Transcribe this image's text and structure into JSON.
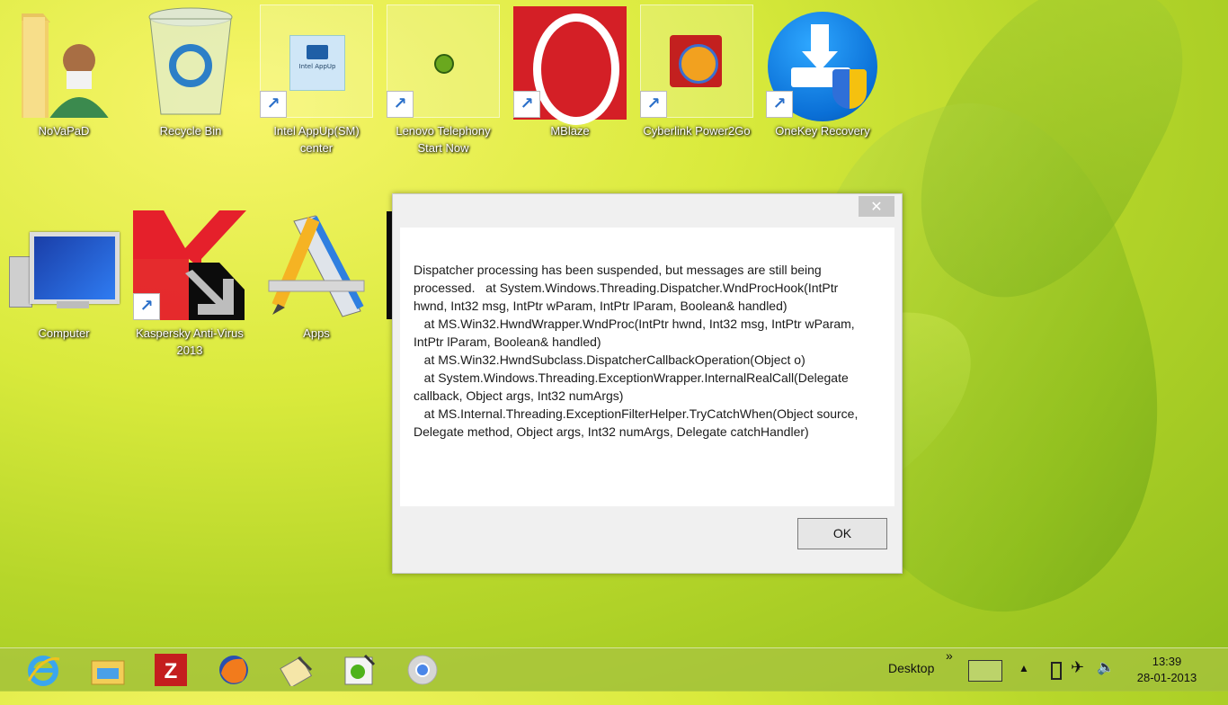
{
  "desktop": {
    "icons": [
      {
        "label": "NoVaPaD",
        "name": "icon-novapad"
      },
      {
        "label": "Recycle Bin",
        "name": "icon-recycle-bin"
      },
      {
        "label": "Intel AppUp(SM) center",
        "name": "icon-intel-appup"
      },
      {
        "label": "Lenovo Telephony Start Now",
        "name": "icon-lenovo-telephony"
      },
      {
        "label": "MBlaze",
        "name": "icon-mblaze"
      },
      {
        "label": "Cyberlink Power2Go",
        "name": "icon-cyberlink"
      },
      {
        "label": "OneKey Recovery",
        "name": "icon-onekey-recovery"
      },
      {
        "label": "Computer",
        "name": "icon-computer"
      },
      {
        "label": "Kaspersky Anti-Virus 2013",
        "name": "icon-kaspersky"
      },
      {
        "label": "Apps",
        "name": "icon-apps"
      }
    ],
    "intel_tile_text": "Intel AppUp"
  },
  "dialog": {
    "close_label": "✕",
    "message": "Dispatcher processing has been suspended, but messages are still being processed.   at System.Windows.Threading.Dispatcher.WndProcHook(IntPtr hwnd, Int32 msg, IntPtr wParam, IntPtr lParam, Boolean& handled)\n   at MS.Win32.HwndWrapper.WndProc(IntPtr hwnd, Int32 msg, IntPtr wParam, IntPtr lParam, Boolean& handled)\n   at MS.Win32.HwndSubclass.DispatcherCallbackOperation(Object o)\n   at System.Windows.Threading.ExceptionWrapper.InternalRealCall(Delegate callback, Object args, Int32 numArgs)\n   at MS.Internal.Threading.ExceptionFilterHelper.TryCatchWhen(Object source, Delegate method, Object args, Int32 numArgs, Delegate catchHandler)",
    "ok_label": "OK"
  },
  "taskbar": {
    "pinned": [
      "internet-explorer-icon",
      "file-explorer-icon",
      "filezilla-icon",
      "firefox-icon",
      "notepad-plus-icon",
      "pad-icon",
      "chrome-icon"
    ],
    "toolbar_label": "Desktop",
    "toolbar_chevron": "»",
    "time": "13:39",
    "date": "28-01-2013"
  },
  "colors": {
    "accent_blue": "#1e6fd0",
    "dialog_bg": "#f0f0f0",
    "taskbar": "#aac440"
  }
}
